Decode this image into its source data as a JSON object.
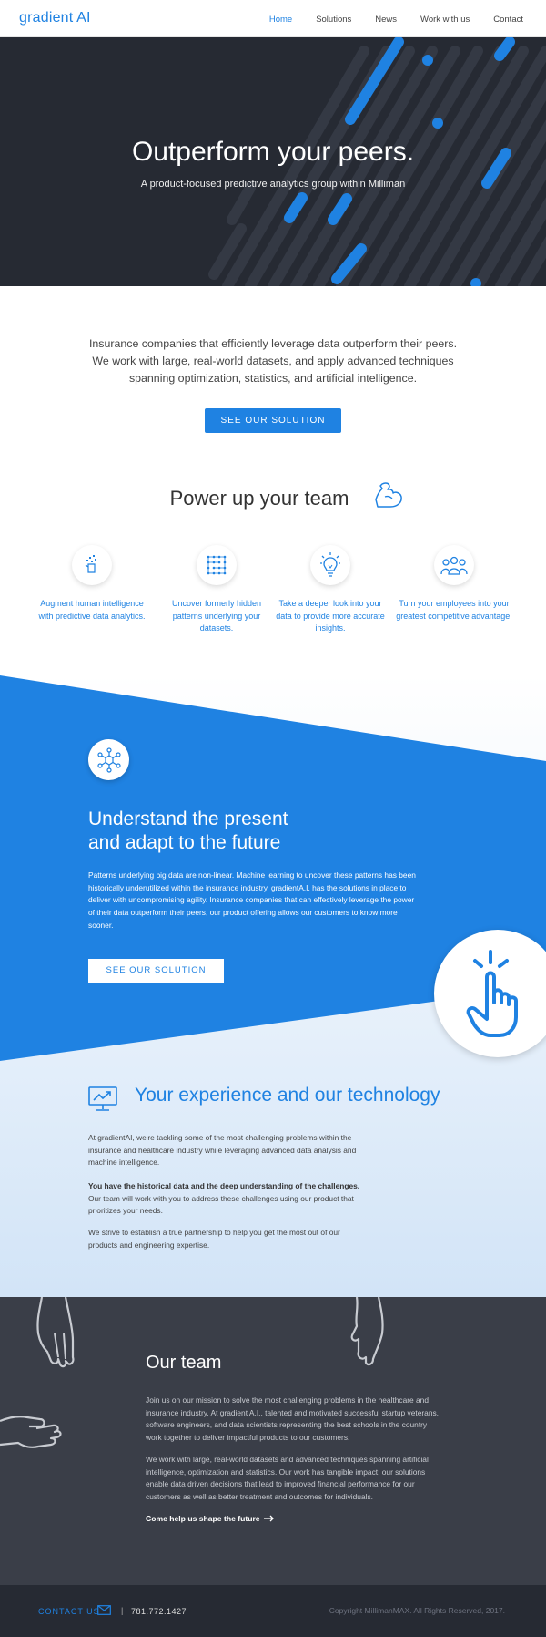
{
  "nav": {
    "logo": "gradient AI",
    "links": [
      "Home",
      "Solutions",
      "News",
      "Work with us",
      "Contact"
    ]
  },
  "hero": {
    "title": "Outperform your peers.",
    "subtitle": "A product-focused predictive analytics group within Milliman"
  },
  "intro": {
    "text": "Insurance companies that efficiently leverage data outperform their peers. We work with large, real-world datasets, and apply advanced techniques spanning optimization, statistics, and artificial intelligence.",
    "button": "SEE OUR SOLUTION"
  },
  "power": {
    "title": "Power up your team",
    "features": [
      {
        "icon": "hand-sparkle-icon",
        "text": "Augment human intelligence with predictive data analytics."
      },
      {
        "icon": "grid-pattern-icon",
        "text": "Uncover formerly hidden patterns underlying your datasets."
      },
      {
        "icon": "lightbulb-icon",
        "text": "Take a deeper look into your data to provide more accurate insights."
      },
      {
        "icon": "people-group-icon",
        "text": "Turn your employees into your greatest competitive advantage."
      }
    ]
  },
  "understand": {
    "title_line1": "Understand the present",
    "title_line2": "and adapt to the future",
    "text": "Patterns underlying big data are non-linear. Machine learning to uncover these patterns has been historically underutilized within the insurance industry. gradientA.I. has the solutions in place to deliver with uncompromising agility. Insurance companies that can effectively leverage the power of their data outperform their peers, our product offering allows our customers to know more sooner.",
    "button": "SEE OUR SOLUTION"
  },
  "tech": {
    "title": "Your experience and our technology",
    "p1": "At gradientAI, we're tackling some of the most challenging problems within the insurance and healthcare industry while leveraging advanced data analysis and machine intelligence.",
    "p2_bold": "You have the historical data and the deep understanding of the challenges.",
    "p2_rest": " Our team will work with you to address these challenges using our product that prioritizes your needs.",
    "p3": "We strive to establish a true partnership to help you get the most out of our products and engineering expertise."
  },
  "team": {
    "title": "Our team",
    "p1": "Join us on our mission to solve the most challenging problems in the healthcare and insurance industry. At gradient A.I., talented and motivated successful startup veterans, software engineers, and data scientists representing the best schools in the country work together to deliver impactful products to our customers.",
    "p2": "We work with large, real-world datasets and advanced techniques spanning artificial intelligence, optimization and statistics. Our work has tangible impact: our solutions enable data driven decisions that lead to improved financial performance for our customers as well as better treatment and outcomes for individuals.",
    "link": "Come help us shape the future"
  },
  "footer": {
    "contact": "CONTACT US",
    "separator": "|",
    "phone": "781.772.1427",
    "copyright": "Copyright MillimanMAX. All Rights Reserved, 2017."
  },
  "colors": {
    "accent": "#1f82e2",
    "dark": "#262a33",
    "team_bg": "#3a3e48"
  }
}
